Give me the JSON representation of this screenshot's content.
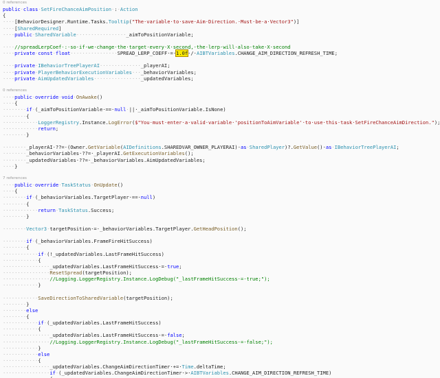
{
  "editor": {
    "lines": [
      {
        "lens": "0 references"
      },
      {
        "tokens": [
          [
            "kw",
            "public"
          ],
          [
            "ws",
            "·"
          ],
          [
            "kw",
            "class"
          ],
          [
            "ws",
            "·"
          ],
          [
            "type",
            "SetFireChanceAimPosition"
          ],
          [
            "ws",
            "·"
          ],
          [
            "text",
            ":"
          ],
          [
            "ws",
            "·"
          ],
          [
            "type",
            "Action"
          ]
        ]
      },
      {
        "tokens": [
          [
            "text",
            "{"
          ]
        ]
      },
      {
        "tokens": [
          [
            "ws",
            "····"
          ],
          [
            "text",
            "[BehaviorDesigner.Runtime.Tasks."
          ],
          [
            "type",
            "Tooltip"
          ],
          [
            "text",
            "("
          ],
          [
            "str",
            "\"The·variable·to·save·Aim·Direction.·Must·be·a·Vector3\""
          ],
          [
            "text",
            ")]"
          ]
        ]
      },
      {
        "tokens": [
          [
            "ws",
            "····"
          ],
          [
            "text",
            "["
          ],
          [
            "type",
            "SharedRequired"
          ],
          [
            "text",
            "]"
          ]
        ]
      },
      {
        "tokens": [
          [
            "ws",
            "····"
          ],
          [
            "kw",
            "public"
          ],
          [
            "ws",
            "·"
          ],
          [
            "type",
            "SharedVariable"
          ],
          [
            "ws",
            "·················"
          ],
          [
            "text",
            "_aimToPositionVariable;"
          ]
        ]
      },
      {
        "tokens": []
      },
      {
        "tokens": [
          [
            "ws",
            "····"
          ],
          [
            "com",
            "//spreadLerpCoef·:·so·if·we·change·the·target·every·X·second,·the·lerp·will·also·take·X·second"
          ]
        ]
      },
      {
        "tokens": [
          [
            "ws",
            "····"
          ],
          [
            "kw",
            "private"
          ],
          [
            "ws",
            "·"
          ],
          [
            "kw",
            "const"
          ],
          [
            "ws",
            "·"
          ],
          [
            "kw",
            "float"
          ],
          [
            "ws",
            "················"
          ],
          [
            "text",
            "SPREAD_LERP_COEFF·=·"
          ],
          [
            "hl",
            "1.0f"
          ],
          [
            "text",
            "·/·"
          ],
          [
            "type",
            "AIBTVariables"
          ],
          [
            "text",
            ".CHANGE_AIM_DIRECTION_REFRESH_TIME;"
          ]
        ]
      },
      {
        "tokens": []
      },
      {
        "tokens": [
          [
            "ws",
            "····"
          ],
          [
            "kw",
            "private"
          ],
          [
            "ws",
            "·"
          ],
          [
            "type",
            "IBehaviorTreePlayerAI"
          ],
          [
            "ws",
            "··············"
          ],
          [
            "text",
            "_playerAI;"
          ]
        ]
      },
      {
        "tokens": [
          [
            "ws",
            "····"
          ],
          [
            "kw",
            "private"
          ],
          [
            "ws",
            "·"
          ],
          [
            "type",
            "PlayerBehaviorExecutionVariables"
          ],
          [
            "ws",
            "···"
          ],
          [
            "text",
            "_behaviorVariables;"
          ]
        ]
      },
      {
        "tokens": [
          [
            "ws",
            "····"
          ],
          [
            "kw",
            "private"
          ],
          [
            "ws",
            "·"
          ],
          [
            "type",
            "AimUpdatedVariables"
          ],
          [
            "ws",
            "················"
          ],
          [
            "text",
            "_updatedVariables;"
          ]
        ]
      },
      {
        "tokens": []
      },
      {
        "lens": "0 references"
      },
      {
        "tokens": [
          [
            "ws",
            "····"
          ],
          [
            "kw",
            "public"
          ],
          [
            "ws",
            "·"
          ],
          [
            "kw",
            "override"
          ],
          [
            "ws",
            "·"
          ],
          [
            "kw",
            "void"
          ],
          [
            "ws",
            "·"
          ],
          [
            "method",
            "OnAwake"
          ],
          [
            "text",
            "()"
          ]
        ]
      },
      {
        "tokens": [
          [
            "ws",
            "····"
          ],
          [
            "text",
            "{"
          ]
        ]
      },
      {
        "tokens": [
          [
            "ws",
            "········"
          ],
          [
            "kw",
            "if"
          ],
          [
            "ws",
            "·"
          ],
          [
            "text",
            "(_aimToPositionVariable·==·"
          ],
          [
            "kw",
            "null"
          ],
          [
            "ws",
            "·"
          ],
          [
            "text",
            "||·_aimToPositionVariable.IsNone)"
          ]
        ]
      },
      {
        "tokens": [
          [
            "ws",
            "········"
          ],
          [
            "text",
            "{"
          ]
        ]
      },
      {
        "tokens": [
          [
            "ws",
            "············"
          ],
          [
            "type",
            "LoggerRegistry"
          ],
          [
            "text",
            ".Instance."
          ],
          [
            "method",
            "LogError"
          ],
          [
            "text",
            "("
          ],
          [
            "str",
            "$\"You·must·enter·a·valid·variable·'positionToAimVariable'·to·use·this·task·SetFireChanceAimDirection.\""
          ],
          [
            "text",
            ");"
          ]
        ]
      },
      {
        "tokens": [
          [
            "ws",
            "············"
          ],
          [
            "kw",
            "return"
          ],
          [
            "text",
            ";"
          ]
        ]
      },
      {
        "tokens": [
          [
            "ws",
            "········"
          ],
          [
            "text",
            "}"
          ]
        ]
      },
      {
        "tokens": []
      },
      {
        "tokens": [
          [
            "ws",
            "········"
          ],
          [
            "text",
            "_playerAI·??=·(Owner."
          ],
          [
            "method",
            "GetVariable"
          ],
          [
            "text",
            "("
          ],
          [
            "type",
            "AIDefinitions"
          ],
          [
            "text",
            ".SHAREDVAR_OWNER_PLAYERAI)·"
          ],
          [
            "kw",
            "as"
          ],
          [
            "ws",
            "·"
          ],
          [
            "type",
            "SharedPlayer"
          ],
          [
            "text",
            ")?."
          ],
          [
            "method",
            "GetValue"
          ],
          [
            "text",
            "()·"
          ],
          [
            "kw",
            "as"
          ],
          [
            "ws",
            "·"
          ],
          [
            "type",
            "IBehaviorTreePlayerAI"
          ],
          [
            "text",
            ";"
          ]
        ]
      },
      {
        "tokens": [
          [
            "ws",
            "········"
          ],
          [
            "text",
            "_behaviorVariables·??=·_playerAI."
          ],
          [
            "method",
            "GetExecutionVariables"
          ],
          [
            "text",
            "();"
          ]
        ]
      },
      {
        "tokens": [
          [
            "ws",
            "········"
          ],
          [
            "text",
            "_updatedVariables·??=·_behaviorVariables.AimUpdatedVariables;"
          ]
        ]
      },
      {
        "tokens": [
          [
            "ws",
            "····"
          ],
          [
            "text",
            "}"
          ]
        ]
      },
      {
        "tokens": []
      },
      {
        "lens": "7 references"
      },
      {
        "tokens": [
          [
            "ws",
            "····"
          ],
          [
            "kw",
            "public"
          ],
          [
            "ws",
            "·"
          ],
          [
            "kw",
            "override"
          ],
          [
            "ws",
            "·"
          ],
          [
            "type",
            "TaskStatus"
          ],
          [
            "ws",
            "·"
          ],
          [
            "method",
            "OnUpdate"
          ],
          [
            "text",
            "()"
          ]
        ]
      },
      {
        "tokens": [
          [
            "ws",
            "····"
          ],
          [
            "text",
            "{"
          ]
        ]
      },
      {
        "tokens": [
          [
            "ws",
            "········"
          ],
          [
            "kw",
            "if"
          ],
          [
            "ws",
            "·"
          ],
          [
            "text",
            "(_behaviorVariables.TargetPlayer·==·"
          ],
          [
            "kw",
            "null"
          ],
          [
            "text",
            ")"
          ]
        ]
      },
      {
        "tokens": [
          [
            "ws",
            "········"
          ],
          [
            "text",
            "{"
          ]
        ]
      },
      {
        "tokens": [
          [
            "ws",
            "············"
          ],
          [
            "kw",
            "return"
          ],
          [
            "ws",
            "·"
          ],
          [
            "type",
            "TaskStatus"
          ],
          [
            "text",
            ".Success;"
          ]
        ]
      },
      {
        "tokens": [
          [
            "ws",
            "········"
          ],
          [
            "text",
            "}"
          ]
        ]
      },
      {
        "tokens": []
      },
      {
        "tokens": [
          [
            "ws",
            "········"
          ],
          [
            "type",
            "Vector3"
          ],
          [
            "ws",
            "·"
          ],
          [
            "text",
            "targetPosition·=·_behaviorVariables.TargetPlayer."
          ],
          [
            "method",
            "GetHeadPosition"
          ],
          [
            "text",
            "();"
          ]
        ]
      },
      {
        "tokens": []
      },
      {
        "tokens": [
          [
            "ws",
            "········"
          ],
          [
            "kw",
            "if"
          ],
          [
            "ws",
            "·"
          ],
          [
            "text",
            "(_behaviorVariables.FrameFireHitSuccess)"
          ]
        ]
      },
      {
        "tokens": [
          [
            "ws",
            "········"
          ],
          [
            "text",
            "{"
          ]
        ]
      },
      {
        "tokens": [
          [
            "ws",
            "············"
          ],
          [
            "kw",
            "if"
          ],
          [
            "ws",
            "·"
          ],
          [
            "text",
            "(!_updatedVariables.LastFrameHitSuccess)"
          ]
        ]
      },
      {
        "tokens": [
          [
            "ws",
            "············"
          ],
          [
            "text",
            "{"
          ]
        ]
      },
      {
        "tokens": [
          [
            "ws",
            "················"
          ],
          [
            "text",
            "_updatedVariables.LastFrameHitSuccess·=·"
          ],
          [
            "kw",
            "true"
          ],
          [
            "text",
            ";"
          ]
        ]
      },
      {
        "tokens": [
          [
            "ws",
            "················"
          ],
          [
            "method",
            "ResetSpread"
          ],
          [
            "text",
            "(targetPosition);"
          ]
        ]
      },
      {
        "tokens": [
          [
            "ws",
            "················"
          ],
          [
            "com",
            "//Logging.LoggerRegistry.Instance.LogDebug(\"_lastFrameHitSuccess·=·true;\");"
          ]
        ]
      },
      {
        "tokens": [
          [
            "ws",
            "············"
          ],
          [
            "text",
            "}"
          ]
        ]
      },
      {
        "tokens": []
      },
      {
        "tokens": [
          [
            "ws",
            "············"
          ],
          [
            "method",
            "SaveDirectionToSharedVariable"
          ],
          [
            "text",
            "(targetPosition);"
          ]
        ]
      },
      {
        "tokens": [
          [
            "ws",
            "········"
          ],
          [
            "text",
            "}"
          ]
        ]
      },
      {
        "tokens": [
          [
            "ws",
            "········"
          ],
          [
            "kw",
            "else"
          ]
        ]
      },
      {
        "tokens": [
          [
            "ws",
            "········"
          ],
          [
            "text",
            "{"
          ]
        ]
      },
      {
        "tokens": [
          [
            "ws",
            "············"
          ],
          [
            "kw",
            "if"
          ],
          [
            "ws",
            "·"
          ],
          [
            "text",
            "(_updatedVariables.LastFrameHitSuccess)"
          ]
        ]
      },
      {
        "tokens": [
          [
            "ws",
            "············"
          ],
          [
            "text",
            "{"
          ]
        ]
      },
      {
        "tokens": [
          [
            "ws",
            "················"
          ],
          [
            "text",
            "_updatedVariables.LastFrameHitSuccess·=·"
          ],
          [
            "kw",
            "false"
          ],
          [
            "text",
            ";"
          ]
        ]
      },
      {
        "tokens": [
          [
            "ws",
            "················"
          ],
          [
            "com",
            "//Logging.LoggerRegistry.Instance.LogDebug(\"_lastFrameHitSuccess·=·false;\");"
          ]
        ]
      },
      {
        "tokens": [
          [
            "ws",
            "············"
          ],
          [
            "text",
            "}"
          ]
        ]
      },
      {
        "tokens": [
          [
            "ws",
            "············"
          ],
          [
            "kw",
            "else"
          ]
        ]
      },
      {
        "tokens": [
          [
            "ws",
            "············"
          ],
          [
            "text",
            "{"
          ]
        ]
      },
      {
        "tokens": [
          [
            "ws",
            "················"
          ],
          [
            "text",
            "_updatedVariables.ChangeAimDirectionTimer·+=·"
          ],
          [
            "type",
            "Time"
          ],
          [
            "text",
            ".deltaTime;"
          ]
        ]
      },
      {
        "tokens": [
          [
            "ws",
            "················"
          ],
          [
            "kw",
            "if"
          ],
          [
            "ws",
            "·"
          ],
          [
            "text",
            "(_updatedVariables.ChangeAimDirectionTimer·>·"
          ],
          [
            "type",
            "AIBTVariables"
          ],
          [
            "text",
            ".CHANGE_AIM_DIRECTION_REFRESH_TIME)"
          ]
        ]
      },
      {
        "tokens": [
          [
            "ws",
            "················"
          ],
          [
            "text",
            "{"
          ]
        ]
      }
    ]
  },
  "colors": {
    "background": "#fafafa",
    "keyword": "#0000ff",
    "type": "#2b91af",
    "string": "#a31515",
    "comment": "#008000",
    "method": "#795e26",
    "whitespace_marker": "#b8b8b8",
    "highlight": "#f7e800"
  }
}
